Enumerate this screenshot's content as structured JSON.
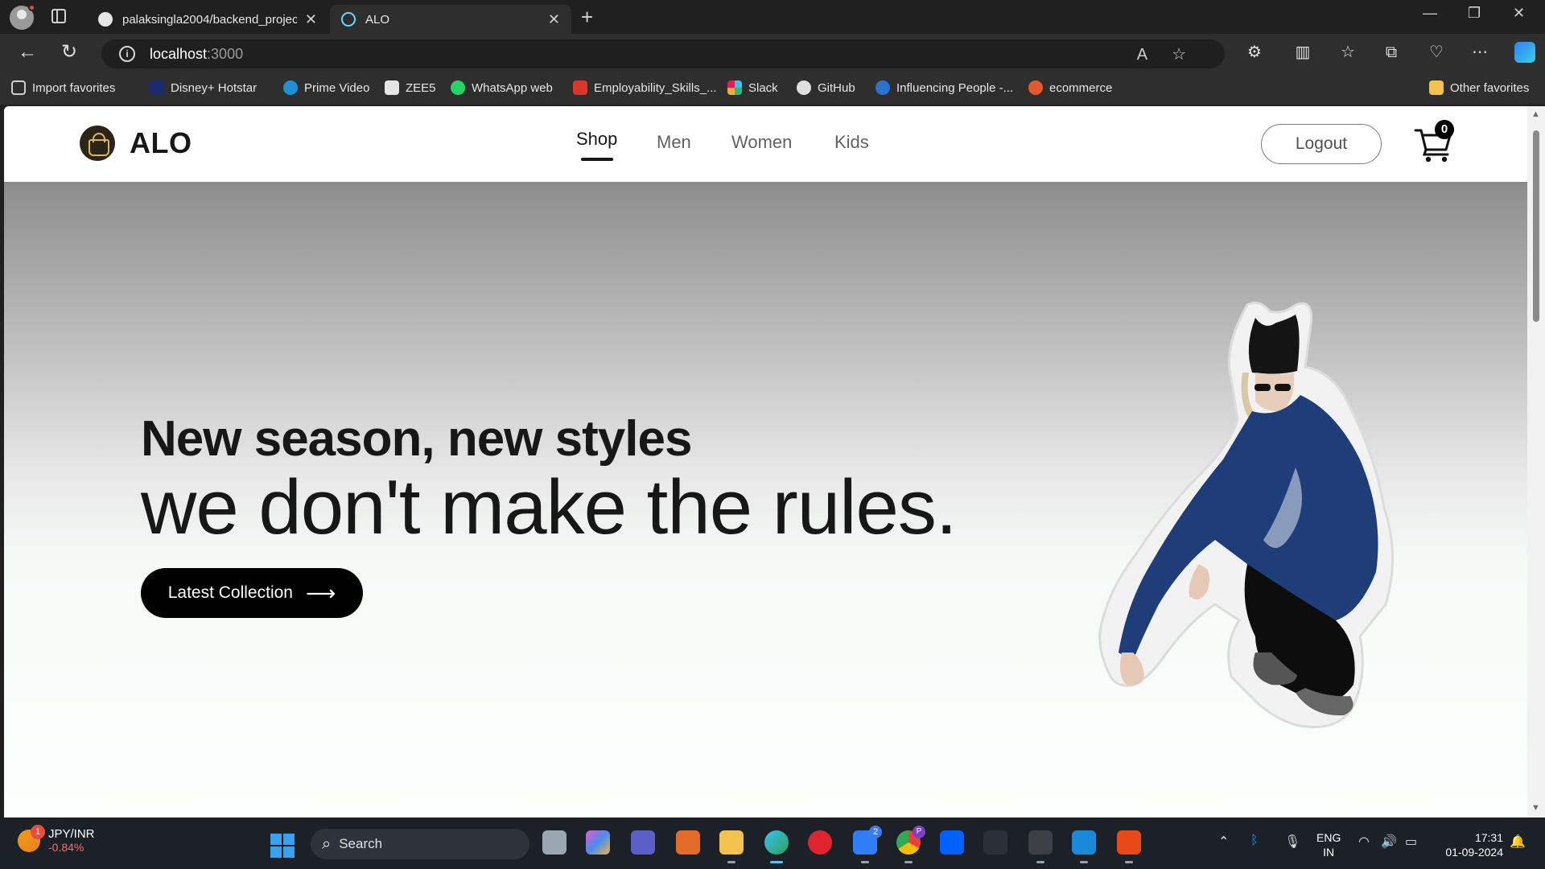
{
  "browser": {
    "tabs": [
      {
        "title": "palaksingla2004/backend_project",
        "active": false,
        "icon": "github-icon"
      },
      {
        "title": "ALO",
        "active": true,
        "icon": "react-icon"
      }
    ],
    "address": {
      "host": "localhost",
      "port": ":3000"
    },
    "favorites": [
      {
        "label": "Import favorites",
        "icon": "import-icon",
        "color": "#cfcfcf"
      },
      {
        "label": "Disney+ Hotstar",
        "icon": "hotstar-icon",
        "color": "#1a2a6c"
      },
      {
        "label": "Prime Video",
        "icon": "primevideo-icon",
        "color": "#1f8fd6"
      },
      {
        "label": "ZEE5",
        "icon": "zee5-icon",
        "color": "#e5e5e5"
      },
      {
        "label": "WhatsApp web",
        "icon": "whatsapp-icon",
        "color": "#25d366"
      },
      {
        "label": "Employability_Skills_...",
        "icon": "pdf-icon",
        "color": "#d9372b"
      },
      {
        "label": "Slack",
        "icon": "slack-icon",
        "color": "#e01e5a"
      },
      {
        "label": "GitHub",
        "icon": "github-icon",
        "color": "#e0e0e0"
      },
      {
        "label": "Influencing People -...",
        "icon": "coursera-icon",
        "color": "#2a73cc"
      },
      {
        "label": "ecommerce",
        "icon": "ecommerce-icon",
        "color": "#e25a2b"
      },
      {
        "label": "Other favorites",
        "icon": "folder-icon",
        "color": "#f2c14e"
      }
    ]
  },
  "site": {
    "brand": "ALO",
    "menu": [
      {
        "label": "Shop",
        "active": true
      },
      {
        "label": "Men",
        "active": false
      },
      {
        "label": "Women",
        "active": false
      },
      {
        "label": "Kids",
        "active": false
      }
    ],
    "logout_label": "Logout",
    "cart_count": "0"
  },
  "hero": {
    "line1": "New season, new styles",
    "line2": "we don't make the rules.",
    "cta_label": "Latest Collection",
    "cta_icon": "arrow-right-icon"
  },
  "taskbar": {
    "weather_title": "JPY/INR",
    "weather_value": "-0.84%",
    "weather_badge": "1",
    "search_label": "Search",
    "lang_line1": "ENG",
    "lang_line2": "IN",
    "time": "17:31",
    "date": "01-09-2024",
    "outlook_badge": "2",
    "chrome_badge": "P"
  },
  "colors": {
    "accent": "#000000",
    "nav_active": "#171717",
    "nav_inactive": "#626262"
  }
}
